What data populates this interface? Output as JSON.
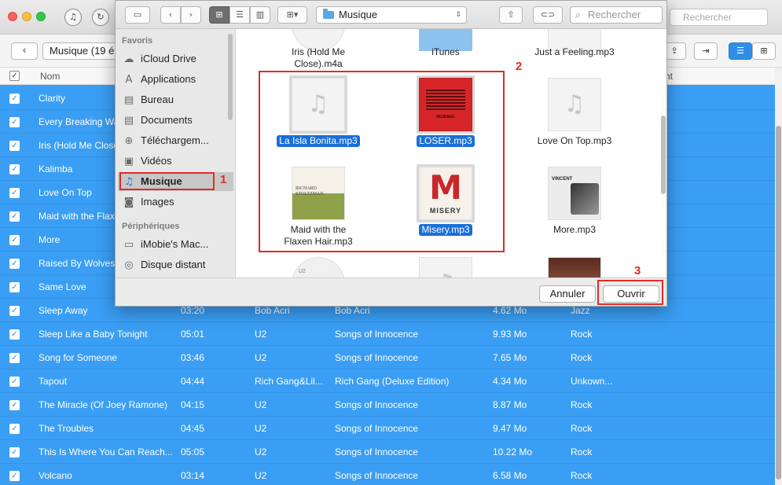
{
  "app": {
    "search_placeholder": "Rechercher",
    "breadcrumb": "Musique (19 é",
    "columns": {
      "name": "Nom",
      "right": "nt"
    },
    "rows_hidden_names": [
      "Clarity",
      "Every Breaking Wa",
      "Iris (Hold Me Close",
      "Kalimba",
      "Love On Top",
      "Maid with the Flax",
      "More",
      "Raised By Wolves",
      "Same Love"
    ],
    "rows": [
      {
        "name": "Sleep Away",
        "duration": "03:20",
        "artist": "Bob Acri",
        "album": "Bob Acri",
        "size": "4.62 Mo",
        "genre": "Jazz"
      },
      {
        "name": "Sleep Like a Baby Tonight",
        "duration": "05:01",
        "artist": "U2",
        "album": "Songs of Innocence",
        "size": "9.93 Mo",
        "genre": "Rock"
      },
      {
        "name": "Song for Someone",
        "duration": "03:46",
        "artist": "U2",
        "album": "Songs of Innocence",
        "size": "7.65 Mo",
        "genre": "Rock"
      },
      {
        "name": "Tapout",
        "duration": "04:44",
        "artist": "Rich Gang&Lil...",
        "album": "Rich Gang (Deluxe Edition)",
        "size": "4.34 Mo",
        "genre": "Unkown..."
      },
      {
        "name": "The Miracle (Of Joey Ramone)",
        "duration": "04:15",
        "artist": "U2",
        "album": "Songs of Innocence",
        "size": "8.87 Mo",
        "genre": "Rock"
      },
      {
        "name": "The Troubles",
        "duration": "04:45",
        "artist": "U2",
        "album": "Songs of Innocence",
        "size": "9.47 Mo",
        "genre": "Rock"
      },
      {
        "name": "This Is Where You Can Reach...",
        "duration": "05:05",
        "artist": "U2",
        "album": "Songs of Innocence",
        "size": "10.22 Mo",
        "genre": "Rock"
      },
      {
        "name": "Volcano",
        "duration": "03:14",
        "artist": "U2",
        "album": "Songs of Innocence",
        "size": "6.58 Mo",
        "genre": "Rock"
      }
    ]
  },
  "dialog": {
    "location": "Musique",
    "search_placeholder": "Rechercher",
    "sidebar": {
      "favorites_header": "Favoris",
      "favorites": [
        "iCloud Drive",
        "Applications",
        "Bureau",
        "Documents",
        "Téléchargem...",
        "Vidéos",
        "Musique",
        "Images"
      ],
      "devices_header": "Périphériques",
      "devices": [
        "iMobie's Mac...",
        "Disque distant"
      ]
    },
    "files": {
      "top": [
        "Iris (Hold Me\nClose).m4a",
        "iTunes",
        "Just a Feeling.mp3"
      ],
      "row1": [
        "La Isla Bonita.mp3",
        "LOSER.mp3",
        "Love On Top.mp3"
      ],
      "row2": [
        "Maid with the\nFlaxen Hair.mp3",
        "Misery.mp3",
        "More.mp3"
      ]
    },
    "album_text": {
      "loser": "BIGBANG",
      "maid_line1": "RICHARD",
      "maid_line2": "STOLTZMAN",
      "misery": "MISERY",
      "more": "VINCENT",
      "u2": "U2"
    },
    "cancel_label": "Annuler",
    "open_label": "Ouvrir"
  },
  "annotations": [
    "1",
    "2",
    "3"
  ]
}
